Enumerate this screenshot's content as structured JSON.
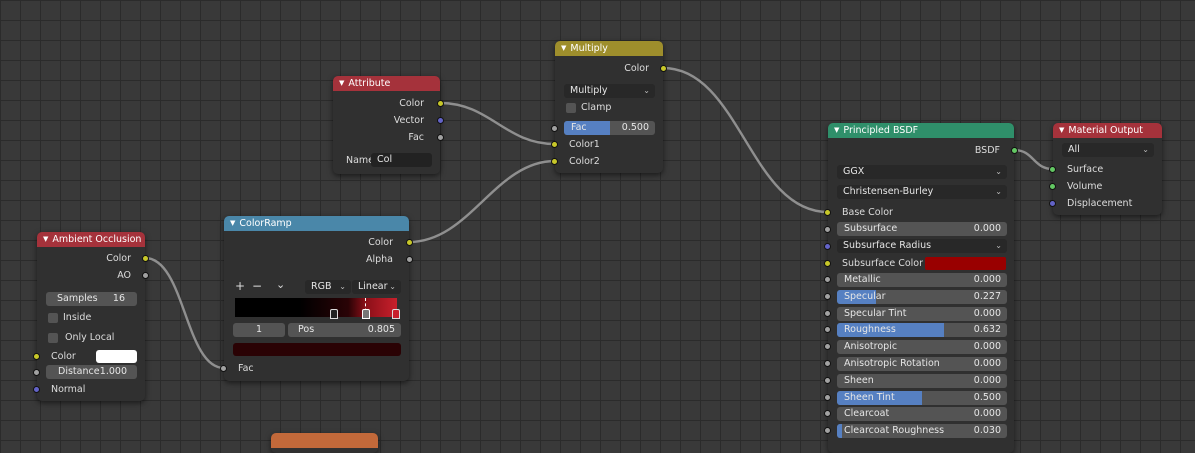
{
  "colors": {
    "attribute_header": "#a5323b",
    "ao_header": "#a5323b",
    "multiply_header": "#9e8e2c",
    "colorramp_header": "#4a87a9",
    "principled_header": "#2f8f6a",
    "output_header": "#a5323b",
    "partial_header": "#c2693a",
    "socket_color": "#c7c729",
    "socket_vector": "#6363c7",
    "socket_value": "#a1a1a1",
    "socket_shader": "#63c763",
    "slider_fill": "#5680c2",
    "subsurface_color": "#990000",
    "ao_color": "#ffffff"
  },
  "attribute": {
    "title": "Attribute",
    "outputs": [
      "Color",
      "Vector",
      "Fac"
    ],
    "name_label": "Name",
    "name_value": "Col"
  },
  "multiply": {
    "title": "Multiply",
    "output": "Color",
    "blend_mode": "Multiply",
    "clamp_label": "Clamp",
    "fac_label": "Fac",
    "fac_value": "0.500",
    "fac_fraction": 0.5,
    "inputs": [
      "Color1",
      "Color2"
    ]
  },
  "ambient_occlusion": {
    "title": "Ambient Occlusion",
    "outputs": [
      "Color",
      "AO"
    ],
    "samples_label": "Samples",
    "samples_value": "16",
    "inside_label": "Inside",
    "only_local_label": "Only Local",
    "color_label": "Color",
    "distance_label": "Distance",
    "distance_value": "1.000",
    "normal_label": "Normal"
  },
  "colorramp": {
    "title": "ColorRamp",
    "outputs": [
      "Color",
      "Alpha"
    ],
    "add_symbol": "+",
    "remove_symbol": "−",
    "menu_symbol": "⌄",
    "color_mode": "RGB",
    "interpolation": "Linear",
    "stop_index": "1",
    "pos_label": "Pos",
    "pos_value": "0.805",
    "fac_label": "Fac"
  },
  "principled": {
    "title": "Principled BSDF",
    "output": "BSDF",
    "distribution": "GGX",
    "subsurface_method": "Christensen-Burley",
    "base_color_label": "Base Color",
    "subsurface_label": "Subsurface",
    "subsurface_value": "0.000",
    "subsurface_radius_label": "Subsurface Radius",
    "subsurface_color_label": "Subsurface Color",
    "params": [
      {
        "label": "Metallic",
        "value": "0.000",
        "fill": 0
      },
      {
        "label": "Specular",
        "value": "0.227",
        "fill": 0.227
      },
      {
        "label": "Specular Tint",
        "value": "0.000",
        "fill": 0
      },
      {
        "label": "Roughness",
        "value": "0.632",
        "fill": 0.632
      },
      {
        "label": "Anisotropic",
        "value": "0.000",
        "fill": 0
      },
      {
        "label": "Anisotropic Rotation",
        "value": "0.000",
        "fill": 0
      },
      {
        "label": "Sheen",
        "value": "0.000",
        "fill": 0
      },
      {
        "label": "Sheen Tint",
        "value": "0.500",
        "fill": 0.5
      },
      {
        "label": "Clearcoat",
        "value": "0.000",
        "fill": 0
      },
      {
        "label": "Clearcoat Roughness",
        "value": "0.030",
        "fill": 0.03
      }
    ]
  },
  "material_output": {
    "title": "Material Output",
    "target": "All",
    "inputs": [
      "Surface",
      "Volume",
      "Displacement"
    ]
  }
}
